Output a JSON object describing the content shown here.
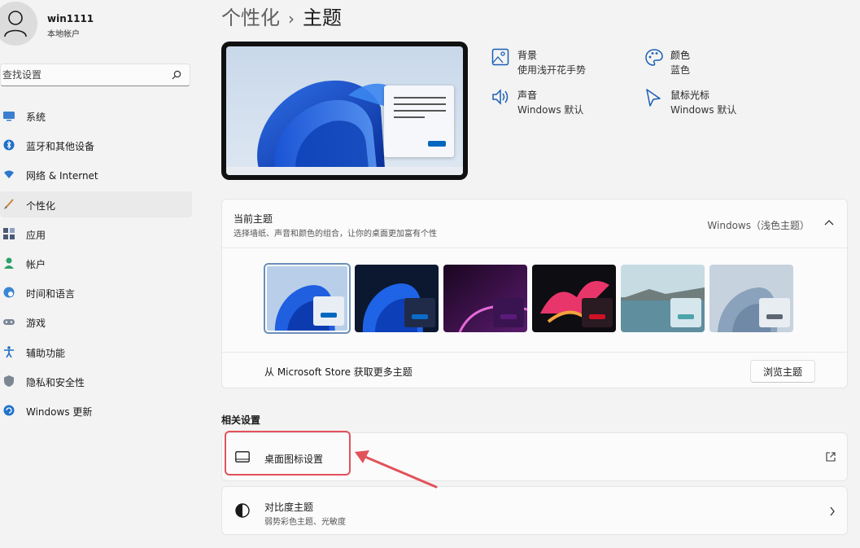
{
  "user": {
    "name": "win1111",
    "account_type": "本地帐户"
  },
  "search": {
    "placeholder": "查找设置"
  },
  "nav": [
    {
      "label": "系统",
      "icon": "monitor-icon"
    },
    {
      "label": "蓝牙和其他设备",
      "icon": "bluetooth-icon"
    },
    {
      "label": "网络 & Internet",
      "icon": "wifi-icon"
    },
    {
      "label": "个性化",
      "icon": "brush-icon",
      "active": true
    },
    {
      "label": "应用",
      "icon": "apps-icon"
    },
    {
      "label": "帐户",
      "icon": "person-icon"
    },
    {
      "label": "时间和语言",
      "icon": "globe-clock-icon"
    },
    {
      "label": "游戏",
      "icon": "gamepad-icon"
    },
    {
      "label": "辅助功能",
      "icon": "accessibility-icon"
    },
    {
      "label": "隐私和安全性",
      "icon": "shield-icon"
    },
    {
      "label": "Windows 更新",
      "icon": "update-icon"
    }
  ],
  "breadcrumb": {
    "parent": "个性化",
    "separator": "›",
    "current": "主题"
  },
  "quick_settings": {
    "background": {
      "title": "背景",
      "value": "使用浅开花手势",
      "icon": "image-icon"
    },
    "color": {
      "title": "颜色",
      "value": "蓝色",
      "icon": "palette-icon"
    },
    "sound": {
      "title": "声音",
      "value": "Windows 默认",
      "icon": "speaker-icon"
    },
    "cursor": {
      "title": "鼠标光标",
      "value": "Windows 默认",
      "icon": "cursor-icon"
    }
  },
  "current_theme": {
    "title": "当前主题",
    "description": "选择墙纸、声音和颜色的组合，让你的桌面更加富有个性",
    "value": "Windows（浅色主题）",
    "themes": [
      {
        "bg": "#a9c4e6",
        "window": "#e9eef5",
        "accent": "#0067c0",
        "selected": true
      },
      {
        "bg": "#0f1d3a",
        "window": "#1f2b48",
        "accent": "#0a6cc8"
      },
      {
        "bg": "#2a0c3a",
        "window": "#3a1450",
        "accent": "#5a1a7a"
      },
      {
        "bg": "#0d0d12",
        "window": "#2a1a22",
        "accent": "#d01225"
      },
      {
        "bg": "#8fb0bf",
        "window": "#d5e6ec",
        "accent": "#4ba3ab"
      },
      {
        "bg": "#b8c6d4",
        "window": "#e8edf2",
        "accent": "#5b6672"
      }
    ],
    "store_text": "从 Microsoft Store 获取更多主题",
    "browse_label": "浏览主题"
  },
  "related": {
    "title": "相关设置",
    "desktop_icons": {
      "title": "桌面图标设置"
    },
    "contrast": {
      "title": "对比度主题",
      "description": "弱势彩色主题、光敏度"
    }
  },
  "colors": {
    "accent": "#0067c0",
    "highlight": "#e2525a"
  }
}
